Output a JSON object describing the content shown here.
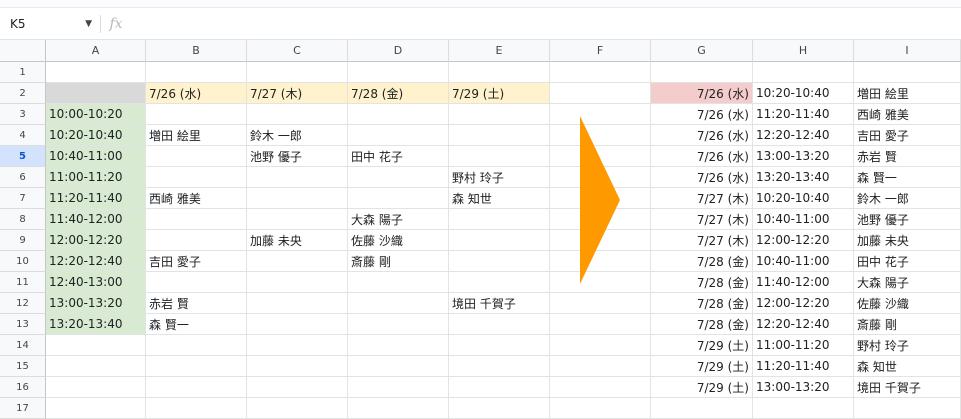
{
  "name_box": {
    "value": "K5",
    "caret_icon": "dropdown-caret-icon"
  },
  "formula_bar": {
    "fx_label": "fx",
    "value": ""
  },
  "columns": [
    "A",
    "B",
    "C",
    "D",
    "E",
    "F",
    "G",
    "H",
    "I"
  ],
  "selected_column": "",
  "selected_row": "5",
  "rows": [
    "1",
    "2",
    "3",
    "4",
    "5",
    "6",
    "7",
    "8",
    "9",
    "10",
    "11",
    "12",
    "13",
    "14",
    "15",
    "16",
    "17"
  ],
  "left_table": {
    "dates": [
      "7/26 (水)",
      "7/27 (木)",
      "7/28 (金)",
      "7/29 (土)"
    ],
    "times": [
      "10:00-10:20",
      "10:20-10:40",
      "10:40-11:00",
      "11:00-11:20",
      "11:20-11:40",
      "11:40-12:00",
      "12:00-12:20",
      "12:20-12:40",
      "12:40-13:00",
      "13:00-13:20",
      "13:20-13:40"
    ],
    "grid": [
      [
        "",
        "",
        "",
        ""
      ],
      [
        "増田 絵里",
        "鈴木 一郎",
        "",
        ""
      ],
      [
        "",
        "池野 優子",
        "田中 花子",
        ""
      ],
      [
        "",
        "",
        "",
        "野村 玲子"
      ],
      [
        "西崎 雅美",
        "",
        "",
        "森 知世"
      ],
      [
        "",
        "",
        "大森 陽子",
        ""
      ],
      [
        "",
        "加藤 未央",
        "佐藤 沙織",
        ""
      ],
      [
        "吉田 愛子",
        "",
        "斎藤 剛",
        ""
      ],
      [
        "",
        "",
        "",
        ""
      ],
      [
        "赤岩 賢",
        "",
        "",
        "境田 千賀子"
      ],
      [
        "森 賢一",
        "",
        "",
        ""
      ]
    ]
  },
  "right_table": [
    {
      "date": "7/26 (水)",
      "time": "10:20-10:40",
      "name": "増田 絵里"
    },
    {
      "date": "7/26 (水)",
      "time": "11:20-11:40",
      "name": "西崎 雅美"
    },
    {
      "date": "7/26 (水)",
      "time": "12:20-12:40",
      "name": "吉田 愛子"
    },
    {
      "date": "7/26 (水)",
      "time": "13:00-13:20",
      "name": "赤岩 賢"
    },
    {
      "date": "7/26 (水)",
      "time": "13:20-13:40",
      "name": "森 賢一"
    },
    {
      "date": "7/27 (木)",
      "time": "10:20-10:40",
      "name": "鈴木 一郎"
    },
    {
      "date": "7/27 (木)",
      "time": "10:40-11:00",
      "name": "池野 優子"
    },
    {
      "date": "7/27 (木)",
      "time": "12:00-12:20",
      "name": "加藤 未央"
    },
    {
      "date": "7/28 (金)",
      "time": "10:40-11:00",
      "name": "田中 花子"
    },
    {
      "date": "7/28 (金)",
      "time": "11:40-12:00",
      "name": "大森 陽子"
    },
    {
      "date": "7/28 (金)",
      "time": "12:00-12:20",
      "name": "佐藤 沙織"
    },
    {
      "date": "7/28 (金)",
      "time": "12:20-12:40",
      "name": "斎藤 剛"
    },
    {
      "date": "7/29 (土)",
      "time": "11:00-11:20",
      "name": "野村 玲子"
    },
    {
      "date": "7/29 (土)",
      "time": "11:20-11:40",
      "name": "森 知世"
    },
    {
      "date": "7/29 (土)",
      "time": "13:00-13:20",
      "name": "境田 千賀子"
    }
  ],
  "colors": {
    "header_yellow": "#fff2cc",
    "time_green": "#d9ead3",
    "corner_gray": "#d9d9d9",
    "highlight_pink": "#f4cccc",
    "arrow_orange": "#ff9900",
    "selection_blue": "#d3e3fd"
  },
  "icons": {
    "filter": "filter-dropdown-icon",
    "arrow": "right-arrow-shape"
  }
}
